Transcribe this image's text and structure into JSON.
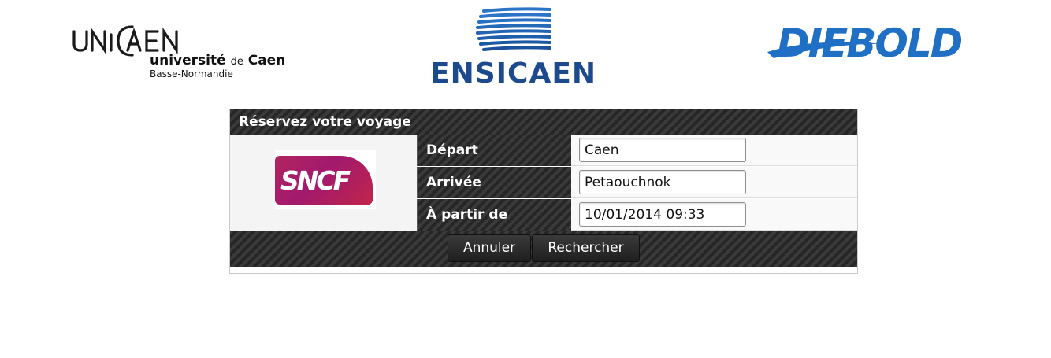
{
  "logos": {
    "unicaen": {
      "wordmark": "UNICAEN",
      "university": "université",
      "de": "de",
      "city": "Caen",
      "region": "Basse-Normandie"
    },
    "ensicaen": "ENSICAEN",
    "diebold": "DIEBOLD"
  },
  "booking": {
    "title": "Réservez votre voyage",
    "partner_logo": "SNCF",
    "fields": {
      "departure": {
        "label": "Départ",
        "value": "Caen"
      },
      "arrival": {
        "label": "Arrivée",
        "value": "Petaouchnok"
      },
      "from_date": {
        "label": "À partir de",
        "value": "10/01/2014 09:33"
      }
    },
    "buttons": {
      "cancel": "Annuler",
      "search": "Rechercher"
    }
  },
  "colors": {
    "header_dark": "#2e2e2e",
    "ensicaen_blue": "#1b4a8d",
    "diebold_blue": "#1f6fc5",
    "sncf_magenta": "#a21a6d"
  }
}
